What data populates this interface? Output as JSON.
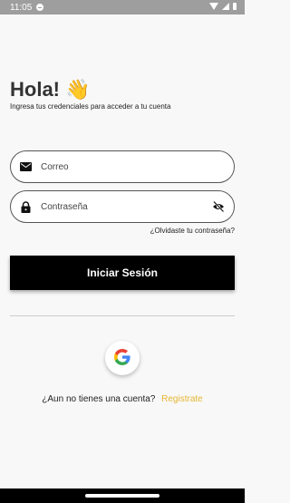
{
  "status_bar": {
    "time": "11:05"
  },
  "greeting": {
    "title": "Hola! 👋",
    "subtitle": "Ingresa tus credenciales para acceder a tu cuenta"
  },
  "email_field": {
    "placeholder": "Correo",
    "value": "",
    "icon": "mail-icon"
  },
  "password_field": {
    "placeholder": "Contraseña",
    "value": "",
    "icon": "lock-icon",
    "toggle_icon": "eye-off-icon"
  },
  "forgot_password": "¿Olvidaste tu contraseña?",
  "login_button": "Iniciar Sesión",
  "google_button": {
    "icon": "google-icon"
  },
  "signup": {
    "prompt": "¿Aun no tienes una cuenta?",
    "link": "Registrate"
  },
  "colors": {
    "accent": "#e6b730",
    "primary_button": "#000000",
    "background": "#f8f8f8"
  }
}
